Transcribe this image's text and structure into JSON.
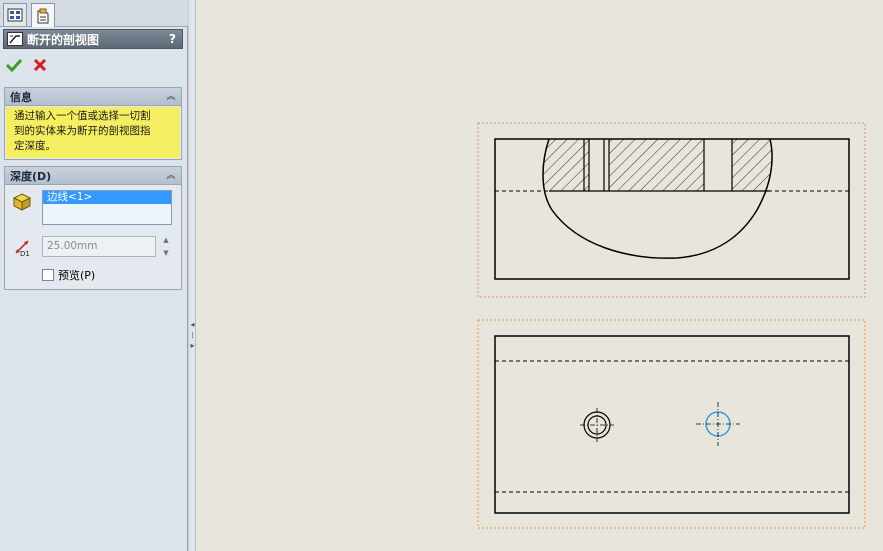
{
  "property_manager": {
    "tabs": [
      {
        "name": "FeatureManager",
        "icon": "feature-tree-icon"
      },
      {
        "name": "PropertyManager",
        "icon": "property-manager-icon",
        "active": true
      }
    ],
    "title": "断开的剖视图",
    "help": "?",
    "ok_icon": "checkmark-icon",
    "cancel_icon": "x-icon",
    "info_group": {
      "title": "信息",
      "text_lines": [
        "通过输入一个值或选择一切割",
        "到的实体来为断开的剖视图指",
        "定深度。"
      ]
    },
    "depth_group": {
      "title": "深度(D)",
      "selection": "边线<1>",
      "depth_value": "25.00mm",
      "preview_label": "预览(P)",
      "preview_checked": false
    }
  },
  "colors": {
    "panel_bg": "#dde3ea",
    "title_bar": "#6a7482",
    "info_bg": "#f5ee60",
    "selection_bg": "#3399ff",
    "canvas_bg": "#e8e6dc",
    "view1_border": "#e0889c",
    "view2_border": "#e89a3a",
    "selected_circle": "#3a9be0"
  }
}
